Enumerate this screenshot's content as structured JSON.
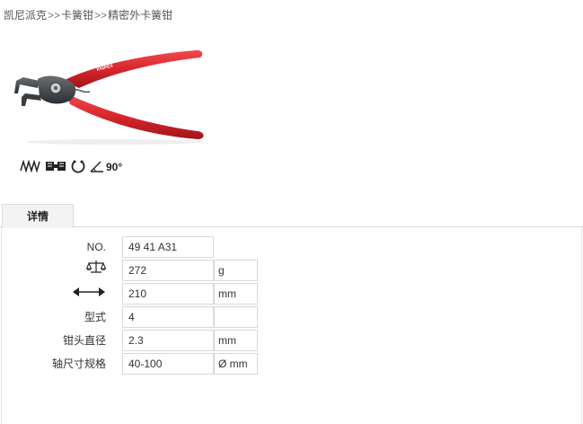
{
  "breadcrumb": {
    "items": [
      "凯尼派克",
      "卡簧钳",
      "精密外卡簧钳"
    ],
    "separator": ">>"
  },
  "product": {
    "brand_print": "KNIPEX",
    "colors": {
      "handle": "#d8262c",
      "head": "#3a3d40"
    }
  },
  "features": {
    "icons": [
      "spring-zigzag-icon",
      "clamp-jaw-icon",
      "circlip-ring-icon",
      "angled-tip-icon"
    ],
    "angle_label": "90°"
  },
  "tabs": [
    {
      "label": "详情"
    }
  ],
  "specs": [
    {
      "label": "NO.",
      "label_icon": null,
      "value": "49 41 A31",
      "unit": null
    },
    {
      "label": "",
      "label_icon": "scale-icon",
      "value": "272",
      "unit": "g"
    },
    {
      "label": "",
      "label_icon": "length-arrow-icon",
      "value": "210",
      "unit": "mm"
    },
    {
      "label": "型式",
      "label_icon": null,
      "value": "4",
      "unit": ""
    },
    {
      "label": "钳头直径",
      "label_icon": null,
      "value": "2.3",
      "unit": "mm"
    },
    {
      "label": "轴尺寸规格",
      "label_icon": null,
      "value": "40-100",
      "unit": "Ø mm"
    }
  ]
}
